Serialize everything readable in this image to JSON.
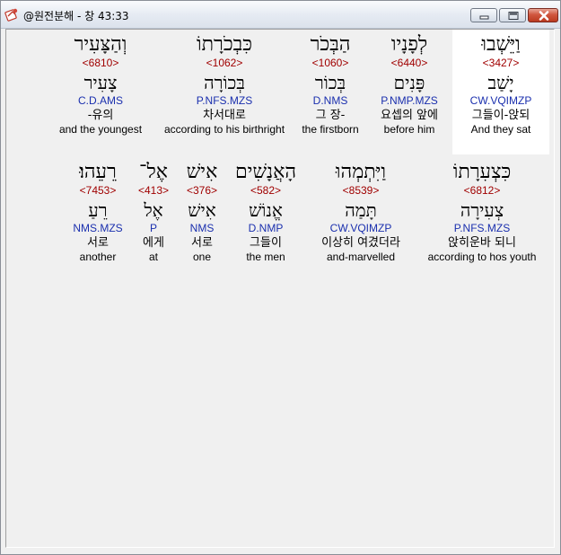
{
  "window": {
    "title": "@원전분해 - 창 43:33"
  },
  "rows": [
    {
      "words": [
        {
          "hebrew": "וַיֵּשְׁבוּ",
          "strong": "<3427>",
          "lemma": "יָשַׁב",
          "morph": "CW.VQIMZP",
          "korean": "그들이-앉되",
          "english": "And they sat"
        },
        {
          "hebrew": "לְפָנָיו",
          "strong": "<6440>",
          "lemma": "פָּנִים",
          "morph": "P.NMP.MZS",
          "korean": "요셉의 앞에",
          "english": "before him"
        },
        {
          "hebrew": "הַבְּכֹר",
          "strong": "<1060>",
          "lemma": "בְּכוֹר",
          "morph": "D.NMS",
          "korean": "그 장-",
          "english": "the firstborn"
        },
        {
          "hebrew": "כִּבְכֹרָתוֹ",
          "strong": "<1062>",
          "lemma": "בְּכוֹרָה",
          "morph": "P.NFS.MZS",
          "korean": "차서대로",
          "english": "according to his birthright"
        },
        {
          "hebrew": "וְהַצָּעִיר",
          "strong": "<6810>",
          "lemma": "צָעִיר",
          "morph": "C.D.AMS",
          "korean": "-유의",
          "english": "and the youngest"
        }
      ]
    },
    {
      "words": [
        {
          "hebrew": "כִּצְעִרָתוֹ",
          "strong": "<6812>",
          "lemma": "צְעִירָה",
          "morph": "P.NFS.MZS",
          "korean": "앉히운바 되니",
          "english": "according to hos youth"
        },
        {
          "hebrew": "וַיִּתְמְהוּ",
          "strong": "<8539>",
          "lemma": "תָּמַה",
          "morph": "CW.VQIMZP",
          "korean": "이상히 여겼더라",
          "english": "and-marvelled"
        },
        {
          "hebrew": "הָאֲנָשִׁים",
          "strong": "<582>",
          "lemma": "אֱנוֹשׁ",
          "morph": "D.NMP",
          "korean": "그들이",
          "english": "the men"
        },
        {
          "hebrew": "אִישׁ",
          "strong": "<376>",
          "lemma": "אִישׁ",
          "morph": "NMS",
          "korean": "서로",
          "english": "one"
        },
        {
          "hebrew": "אֶל־",
          "strong": "<413>",
          "lemma": "אֶל",
          "morph": "P",
          "korean": "에게",
          "english": "at"
        },
        {
          "hebrew": "רֵעֵהוּ׃",
          "strong": "<7453>",
          "lemma": "רֵעַ",
          "morph": "NMS.MZS",
          "korean": "서로",
          "english": "another"
        }
      ]
    }
  ],
  "colors": {
    "strong_number": "#a00000",
    "morphology": "#1a2fae",
    "highlight_background": "#ffffff",
    "window_background": "#f0f0f0"
  },
  "icons": [
    "app-icon",
    "minimize-icon",
    "maximize-icon",
    "close-icon"
  ]
}
